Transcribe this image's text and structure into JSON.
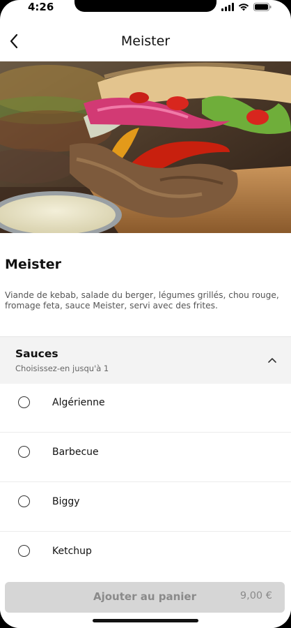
{
  "status_bar": {
    "time": "4:26",
    "icons": [
      "signal-icon",
      "wifi-icon",
      "battery-icon"
    ]
  },
  "nav": {
    "title": "Meister",
    "back_icon": "chevron-left-icon"
  },
  "product": {
    "name": "Meister",
    "description": "Viande de kebab, salade du berger, légumes grillés, chou rouge, fromage feta, sauce Meister, servi avec des frites."
  },
  "sauces": {
    "title": "Sauces",
    "subtitle": "Choisissez-en jusqu'à 1",
    "toggle_icon": "chevron-up-icon",
    "options": [
      {
        "label": "Algérienne",
        "selected": false
      },
      {
        "label": "Barbecue",
        "selected": false
      },
      {
        "label": "Biggy",
        "selected": false
      },
      {
        "label": "Ketchup",
        "selected": false
      }
    ]
  },
  "cart": {
    "button_label": "Ajouter au panier",
    "price": "9,00 €",
    "enabled": false
  },
  "colors": {
    "button_disabled_bg": "#d6d6d6",
    "button_disabled_text": "#8a8a8a",
    "section_bg": "#f3f3f3"
  }
}
